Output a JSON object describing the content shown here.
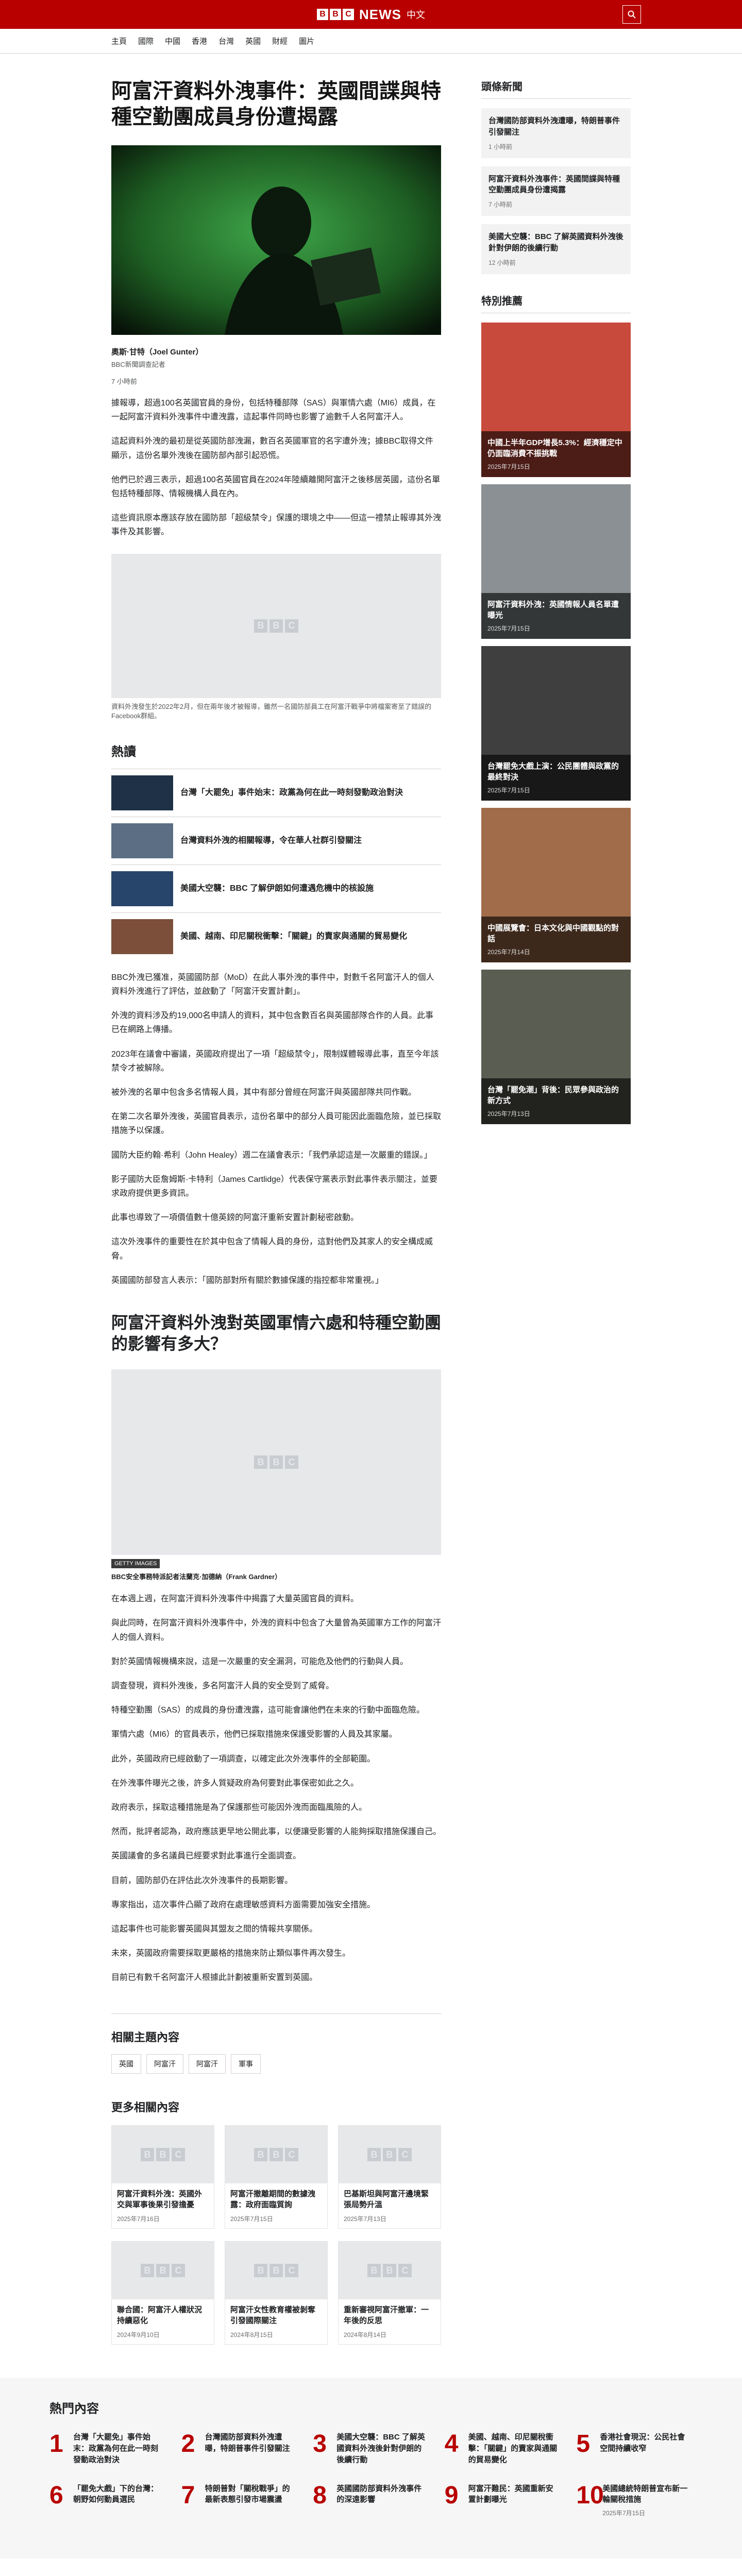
{
  "header": {
    "brand_letters": [
      "B",
      "B",
      "C"
    ],
    "brand_news": "NEWS",
    "brand_lang": "中文",
    "nav": [
      "主頁",
      "國際",
      "中國",
      "香港",
      "台灣",
      "英國",
      "財經",
      "圖片"
    ]
  },
  "article": {
    "headline": "阿富汗資料外洩事件：英國間諜與特種空勤團成員身份遭揭露",
    "hero_caption": "",
    "byline_name": "奧斯·甘特（Joel Gunter）",
    "byline_role": "BBC新聞調查記者",
    "date": "7 小時前",
    "paragraphs": [
      "據報導，超過100名英國官員的身份，包括特種部隊（SAS）與軍情六處（MI6）成員，在一起阿富汗資料外洩事件中遭洩露，這起事件同時也影響了逾數千人名阿富汗人。",
      "這起資料外洩的最初是從英國防部洩漏，數百名英國軍官的名字遭外洩；據BBC取得文件顯示，這份名單外洩後在國防部內部引起恐慌。",
      "他們已於週三表示，超過100名英國官員在2024年陸續離開阿富汗之後移居英國，這份名單包括特種部隊、情報機構人員在內。",
      "這些資訊原本應該存放在國防部「超級禁令」保護的環境之中——但這一禮禁止報導其外洩事件及其影響。"
    ],
    "photo_caption": "資料外洩發生於2022年2月，但在兩年後才被報導，雖然一名國防部員工在阿富汗戰爭中將檔案寄至了錯誤的Facebook群組。"
  },
  "popular": {
    "title": "熱讀",
    "items": [
      "台灣「大罷免」事件始末：政黨為何在此一時刻發動政治對決",
      "台灣資料外洩的相關報導，令在華人社群引發關注",
      "美國大空襲：BBC 了解伊朗如何遭遇危機中的核設施",
      "美國、越南、印尼關稅衝擊：「關鍵」的賣家與通關的貿易變化"
    ]
  },
  "body2": {
    "paragraphs": [
      "BBC外洩已獲准，英國國防部（MoD）在此人事外洩的事件中，對數千名阿富汗人的個人資料外洩進行了評估，並啟動了「阿富汗安置計劃」。",
      "外洩的資料涉及約19,000名申請人的資料，其中包含數百名與英國部隊合作的人員。此事已在網路上傳播。",
      "2023年在議會中審議，英國政府提出了一項「超級禁令」，限制媒體報導此事，直至今年該禁令才被解除。",
      "被外洩的名單中包含多名情報人員，其中有部分曾經在阿富汗與英國部隊共同作戰。",
      "在第二次名單外洩後，英國官員表示，這份名單中的部分人員可能因此面臨危險，並已採取措施予以保護。",
      "國防大臣約翰·希利（John Healey）週二在議會表示：「我們承認這是一次嚴重的錯誤。」",
      "影子國防大臣詹姆斯·卡特利（James Cartlidge）代表保守黨表示對此事件表示關注，並要求政府提供更多資訊。",
      "此事也導致了一項價值數十億英鎊的阿富汗重新安置計劃秘密啟動。",
      "這次外洩事件的重要性在於其中包含了情報人員的身份，這對他們及其家人的安全構成威脅。",
      "英國國防部發言人表示：「國防部對所有關於數據保護的指控都非常重視。」"
    ]
  },
  "section2": {
    "heading": "阿富汗資料外洩對英國軍情六處和特種空勤團的影響有多大？",
    "gallery_tag": "GETTY IMAGES",
    "caption": "BBC安全事務特派記者法蘭克·加德納（Frank Gardner）",
    "paragraphs": [
      "在本週上週，在阿富汗資料外洩事件中揭露了大量英國官員的資料。",
      "與此同時，在阿富汗資料外洩事件中，外洩的資料中包含了大量曾為英國軍方工作的阿富汗人的個人資料。",
      "對於英國情報機構來說，這是一次嚴重的安全漏洞，可能危及他們的行動與人員。",
      "調查發現，資料外洩後，多名阿富汗人員的安全受到了威脅。",
      "特種空勤團（SAS）的成員的身份遭洩露，這可能會讓他們在未來的行動中面臨危險。",
      "軍情六處（MI6）的官員表示，他們已採取措施來保護受影響的人員及其家屬。",
      "此外，英國政府已經啟動了一項調查，以確定此次外洩事件的全部範圍。",
      "在外洩事件曝光之後，許多人質疑政府為何要對此事保密如此之久。",
      "政府表示，採取這種措施是為了保護那些可能因外洩而面臨風險的人。",
      "然而，批評者認為，政府應該更早地公開此事，以便讓受影響的人能夠採取措施保護自己。",
      "英國議會的多名議員已經要求對此事進行全面調查。",
      "目前，國防部仍在評估此次外洩事件的長期影響。",
      "專家指出，這次事件凸顯了政府在處理敏感資料方面需要加強安全措施。",
      "這起事件也可能影響英國與其盟友之間的情報共享關係。",
      "未來，英國政府需要採取更嚴格的措施來防止類似事件再次發生。",
      "目前已有數千名阿富汗人根據此計劃被重新安置到英國。"
    ]
  },
  "topics": {
    "title": "相關主題內容",
    "chips": [
      "英國",
      "阿富汗",
      "阿富汗",
      "軍事"
    ]
  },
  "more": {
    "title": "更多相關內容",
    "cards": [
      {
        "title": "阿富汗資料外洩：英國外交與軍事後果引發擔憂",
        "date": "2025年7月16日"
      },
      {
        "title": "阿富汗撤離期間的數據洩露：政府面臨質詢",
        "date": "2025年7月15日"
      },
      {
        "title": "巴基斯坦與阿富汗邊境緊張局勢升溫",
        "date": "2025年7月13日"
      },
      {
        "title": "聯合國：阿富汗人權狀況持續惡化",
        "date": "2024年9月10日"
      },
      {
        "title": "阿富汗女性教育權被剝奪引發國際關注",
        "date": "2024年8月15日"
      },
      {
        "title": "重新審視阿富汗撤軍：一年後的反思",
        "date": "2024年8月14日"
      }
    ]
  },
  "aside": {
    "news_title": "頭條新聞",
    "news": [
      {
        "title": "台灣國防部資料外洩遭曝，特朗普事件引發關注",
        "date": "1 小時前"
      },
      {
        "title": "阿富汗資料外洩事件：英國間諜與特種空勤團成員身份遭揭露",
        "date": "7 小時前"
      },
      {
        "title": "美國大空襲：BBC 了解英國資料外洩後針對伊朗的後續行動",
        "date": "12 小時前"
      }
    ],
    "featured_title": "特別推薦",
    "featured": [
      {
        "title": "中國上半年GDP增長5.3%：經濟穩定中仍面臨消費不振挑戰",
        "date": "2025年7月15日",
        "color": "#c84a3c"
      },
      {
        "title": "阿富汗資料外洩：英國情報人員名單遭曝光",
        "date": "2025年7月15日",
        "color": "#8a9094"
      },
      {
        "title": "台灣罷免大戲上演：公民團體與政黨的最終對決",
        "date": "2025年7月15日",
        "color": "#3f3f3f"
      },
      {
        "title": "中國展覽會：日本文化與中國觀點的對話",
        "date": "2025年7月14日",
        "color": "#a16c4a"
      },
      {
        "title": "台灣「罷免潮」背後：民眾參與政治的新方式",
        "date": "2025年7月13日",
        "color": "#5a5e52"
      }
    ]
  },
  "most_read": {
    "title": "熱門內容",
    "items": [
      {
        "n": "1",
        "title": "台灣「大罷免」事件始末：政黨為何在此一時刻發動政治對決"
      },
      {
        "n": "2",
        "title": "台灣國防部資料外洩遭曝，特朗普事件引發關注"
      },
      {
        "n": "3",
        "title": "美國大空襲：BBC 了解英國資料外洩後針對伊朗的後續行動"
      },
      {
        "n": "4",
        "title": "美國、越南、印尼關稅衝擊：「關鍵」的賣家與通關的貿易變化"
      },
      {
        "n": "5",
        "title": "香港社會現況：公民社會空間持續收窄"
      },
      {
        "n": "6",
        "title": "「罷免大戲」下的台灣：朝野如何動員選民"
      },
      {
        "n": "7",
        "title": "特朗普對「關稅戰爭」的最新表態引發市場震盪"
      },
      {
        "n": "8",
        "title": "英國國防部資料外洩事件的深遠影響"
      },
      {
        "n": "9",
        "title": "阿富汗難民：英國重新安置計劃曝光"
      },
      {
        "n": "10",
        "title": "美國總統特朗普宣布新一輪關稅措施",
        "date": "2025年7月15日"
      }
    ]
  }
}
